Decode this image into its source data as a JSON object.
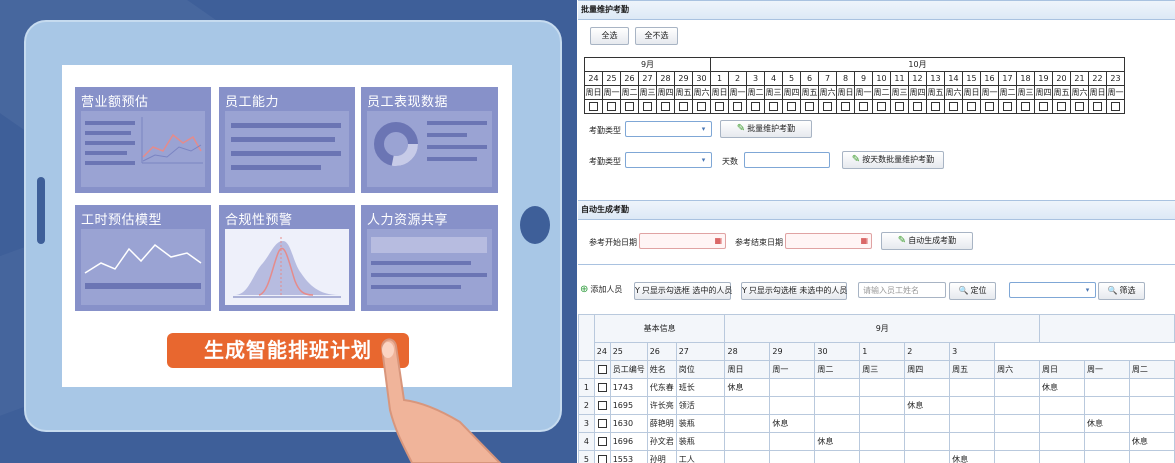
{
  "illustration": {
    "cards": [
      {
        "title": "营业额预估"
      },
      {
        "title": "员工能力"
      },
      {
        "title": "员工表现数据"
      },
      {
        "title": "工时预估模型"
      },
      {
        "title": "合规性预警"
      },
      {
        "title": "人力资源共享"
      }
    ],
    "cta_label": "生成智能排班计划"
  },
  "batch": {
    "section_title": "批量维护考勤",
    "select_all_label": "全选",
    "deselect_all_label": "全不选",
    "month_labels": [
      "9月",
      "10月"
    ],
    "days": [
      "24",
      "25",
      "26",
      "27",
      "28",
      "29",
      "30",
      "1",
      "2",
      "3",
      "4",
      "5",
      "6",
      "7",
      "8",
      "9",
      "10",
      "11",
      "12",
      "13",
      "14",
      "15",
      "16",
      "17",
      "18",
      "19",
      "20",
      "21",
      "22",
      "23"
    ],
    "weekdays": [
      "周日",
      "周一",
      "周二",
      "周三",
      "周四",
      "周五",
      "周六",
      "周日",
      "周一",
      "周二",
      "周三",
      "周四",
      "周五",
      "周六",
      "周日",
      "周一",
      "周二",
      "周三",
      "周四",
      "周五",
      "周六",
      "周日",
      "周一",
      "周二",
      "周三",
      "周四",
      "周五",
      "周六",
      "周日",
      "周一"
    ],
    "attendance_type_label": "考勤类型",
    "batch_maintain_label": "批量维护考勤",
    "attendance_type_label2": "考勤类型",
    "days_label": "天数",
    "by_days_label": "按天数批量维护考勤"
  },
  "auto": {
    "section_title": "自动生成考勤",
    "start_date_label": "参考开始日期",
    "end_date_label": "参考结束日期",
    "generate_label": "自动生成考勤"
  },
  "toolbar": {
    "add_person_label": "添加人员",
    "show_selected_label": "只显示勾选框 选中的人员",
    "show_unselected_label": "只显示勾选框 未选中的人员",
    "name_placeholder": "请输入员工姓名",
    "locate_label": "定位",
    "filter_label": "筛选"
  },
  "table": {
    "basic_info_label": "基本信息",
    "month_label": "9月",
    "col_emp_no": "员工编号",
    "col_name": "姓名",
    "col_position": "岗位",
    "days": [
      "24",
      "25",
      "26",
      "27",
      "28",
      "29",
      "30",
      "1",
      "2",
      "3"
    ],
    "weekdays": [
      "周日",
      "周一",
      "周二",
      "周三",
      "周四",
      "周五",
      "周六",
      "周日",
      "周一",
      "周二"
    ],
    "rows": [
      {
        "no": "1",
        "emp": "1743",
        "name": "代东春",
        "pos": "班长",
        "cells": [
          "休息",
          "",
          "",
          "",
          "",
          "",
          "",
          "休息",
          "",
          ""
        ]
      },
      {
        "no": "2",
        "emp": "1695",
        "name": "许长亮",
        "pos": "领活",
        "cells": [
          "",
          "",
          "",
          "",
          "休息",
          "",
          "",
          "",
          "",
          ""
        ]
      },
      {
        "no": "3",
        "emp": "1630",
        "name": "薛艳明",
        "pos": "装瓶",
        "cells": [
          "",
          "休息",
          "",
          "",
          "",
          "",
          "",
          "",
          "休息",
          ""
        ]
      },
      {
        "no": "4",
        "emp": "1696",
        "name": "孙文君",
        "pos": "装瓶",
        "cells": [
          "",
          "",
          "休息",
          "",
          "",
          "",
          "",
          "",
          "",
          "休息"
        ]
      },
      {
        "no": "5",
        "emp": "1553",
        "name": "孙明",
        "pos": "工人",
        "cells": [
          "",
          "",
          "",
          "",
          "",
          "休息",
          "",
          "",
          "",
          ""
        ]
      }
    ]
  },
  "colors": {
    "accent": "#e8672f",
    "card": "#8791c9",
    "header": "#dde9f6"
  }
}
